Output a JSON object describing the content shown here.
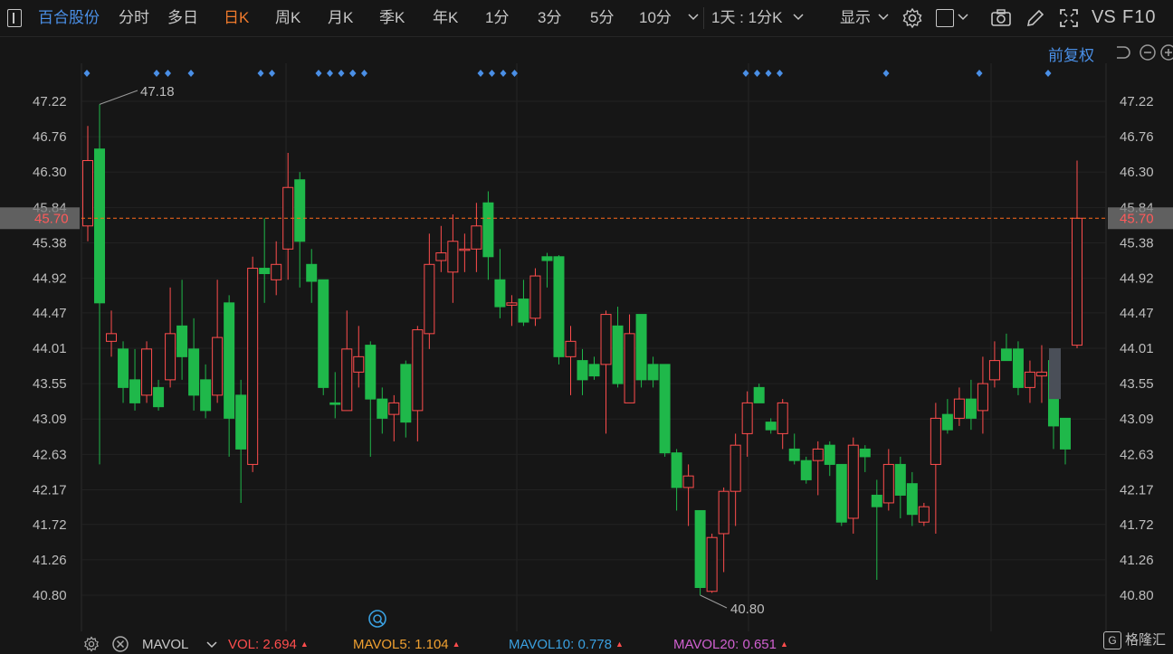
{
  "toolbar": {
    "stock_name": "百合股份",
    "periods": [
      "分时",
      "多日",
      "日K",
      "周K",
      "月K",
      "季K",
      "年K",
      "1分",
      "3分",
      "5分",
      "10分"
    ],
    "active_period": "日K",
    "interval_selector": "1天 : 1分K",
    "display_label": "显示",
    "vs_label": "VS",
    "f10_label": "F10"
  },
  "adjust_label": "前复权",
  "price_axis": {
    "ticks": [
      "47.22",
      "46.76",
      "46.30",
      "45.84",
      "45.38",
      "44.92",
      "44.47",
      "44.01",
      "43.55",
      "43.09",
      "42.63",
      "42.17",
      "41.72",
      "41.26",
      "40.80"
    ],
    "current_price": "45.70",
    "max_marker": "47.18",
    "min_marker": "40.80"
  },
  "colors": {
    "up": "#ff4d4d",
    "down": "#1fb84a",
    "marker": "#4a8fe6",
    "dashed": "#ff6a1a",
    "current_bg": "#7a7a7a"
  },
  "chart_data": {
    "type": "candlestick",
    "ylim": [
      40.8,
      47.22
    ],
    "candles": [
      {
        "o": 45.6,
        "c": 46.45,
        "h": 46.9,
        "l": 45.4
      },
      {
        "o": 46.6,
        "c": 44.6,
        "h": 47.18,
        "l": 42.5
      },
      {
        "o": 44.1,
        "c": 44.2,
        "h": 44.5,
        "l": 43.9
      },
      {
        "o": 44.0,
        "c": 43.5,
        "h": 44.1,
        "l": 43.3
      },
      {
        "o": 43.6,
        "c": 43.3,
        "h": 44.0,
        "l": 43.2
      },
      {
        "o": 43.4,
        "c": 44.0,
        "h": 44.1,
        "l": 43.3
      },
      {
        "o": 43.5,
        "c": 43.25,
        "h": 43.6,
        "l": 43.2
      },
      {
        "o": 43.6,
        "c": 44.2,
        "h": 44.8,
        "l": 43.5
      },
      {
        "o": 44.3,
        "c": 43.9,
        "h": 44.9,
        "l": 43.6
      },
      {
        "o": 44.0,
        "c": 43.4,
        "h": 44.4,
        "l": 43.2
      },
      {
        "o": 43.6,
        "c": 43.2,
        "h": 43.8,
        "l": 43.1
      },
      {
        "o": 43.4,
        "c": 44.15,
        "h": 44.9,
        "l": 43.3
      },
      {
        "o": 44.6,
        "c": 43.1,
        "h": 44.7,
        "l": 42.6
      },
      {
        "o": 43.4,
        "c": 42.7,
        "h": 43.6,
        "l": 42.0
      },
      {
        "o": 42.5,
        "c": 45.05,
        "h": 45.2,
        "l": 42.4
      },
      {
        "o": 45.05,
        "c": 44.98,
        "h": 45.7,
        "l": 44.6
      },
      {
        "o": 44.9,
        "c": 45.1,
        "h": 45.4,
        "l": 44.7
      },
      {
        "o": 45.3,
        "c": 46.1,
        "h": 46.55,
        "l": 44.9
      },
      {
        "o": 46.2,
        "c": 45.4,
        "h": 46.3,
        "l": 44.8
      },
      {
        "o": 45.1,
        "c": 44.88,
        "h": 45.3,
        "l": 44.6
      },
      {
        "o": 44.9,
        "c": 43.5,
        "h": 44.9,
        "l": 43.4
      },
      {
        "o": 43.3,
        "c": 43.28,
        "h": 43.7,
        "l": 43.1
      },
      {
        "o": 43.2,
        "c": 44.0,
        "h": 44.5,
        "l": 43.2
      },
      {
        "o": 43.7,
        "c": 43.9,
        "h": 44.3,
        "l": 43.5
      },
      {
        "o": 44.05,
        "c": 43.35,
        "h": 44.1,
        "l": 42.6
      },
      {
        "o": 43.35,
        "c": 43.1,
        "h": 43.5,
        "l": 42.9
      },
      {
        "o": 43.15,
        "c": 43.3,
        "h": 43.4,
        "l": 42.8
      },
      {
        "o": 43.8,
        "c": 43.05,
        "h": 43.85,
        "l": 42.85
      },
      {
        "o": 43.2,
        "c": 44.25,
        "h": 44.3,
        "l": 42.8
      },
      {
        "o": 44.2,
        "c": 45.1,
        "h": 45.5,
        "l": 44.0
      },
      {
        "o": 45.15,
        "c": 45.25,
        "h": 45.6,
        "l": 45.0
      },
      {
        "o": 45.0,
        "c": 45.4,
        "h": 45.75,
        "l": 44.6
      },
      {
        "o": 45.3,
        "c": 45.3,
        "h": 45.5,
        "l": 45.0
      },
      {
        "o": 45.3,
        "c": 45.6,
        "h": 45.9,
        "l": 45.0
      },
      {
        "o": 45.9,
        "c": 45.2,
        "h": 46.05,
        "l": 44.9
      },
      {
        "o": 44.9,
        "c": 44.55,
        "h": 45.3,
        "l": 44.4
      },
      {
        "o": 44.57,
        "c": 44.6,
        "h": 44.7,
        "l": 44.3
      },
      {
        "o": 44.65,
        "c": 44.35,
        "h": 44.9,
        "l": 44.3
      },
      {
        "o": 44.4,
        "c": 44.95,
        "h": 45.05,
        "l": 44.3
      },
      {
        "o": 45.2,
        "c": 45.15,
        "h": 45.25,
        "l": 44.8
      },
      {
        "o": 45.2,
        "c": 43.9,
        "h": 45.22,
        "l": 43.8
      },
      {
        "o": 43.9,
        "c": 44.1,
        "h": 44.3,
        "l": 43.4
      },
      {
        "o": 43.85,
        "c": 43.6,
        "h": 44.0,
        "l": 43.4
      },
      {
        "o": 43.8,
        "c": 43.65,
        "h": 43.9,
        "l": 43.6
      },
      {
        "o": 43.8,
        "c": 44.45,
        "h": 44.5,
        "l": 42.9
      },
      {
        "o": 44.3,
        "c": 43.55,
        "h": 44.55,
        "l": 43.5
      },
      {
        "o": 43.3,
        "c": 44.2,
        "h": 44.45,
        "l": 43.3
      },
      {
        "o": 44.45,
        "c": 43.6,
        "h": 44.45,
        "l": 43.5
      },
      {
        "o": 43.8,
        "c": 43.6,
        "h": 43.9,
        "l": 43.5
      },
      {
        "o": 43.8,
        "c": 42.65,
        "h": 43.8,
        "l": 42.6
      },
      {
        "o": 42.65,
        "c": 42.2,
        "h": 42.7,
        "l": 41.9
      },
      {
        "o": 42.2,
        "c": 42.35,
        "h": 42.5,
        "l": 41.7
      },
      {
        "o": 41.9,
        "c": 40.9,
        "h": 41.9,
        "l": 40.8
      },
      {
        "o": 40.85,
        "c": 41.55,
        "h": 41.6,
        "l": 40.83
      },
      {
        "o": 41.6,
        "c": 42.15,
        "h": 42.2,
        "l": 41.1
      },
      {
        "o": 42.15,
        "c": 42.75,
        "h": 42.9,
        "l": 41.7
      },
      {
        "o": 42.9,
        "c": 43.3,
        "h": 43.45,
        "l": 42.6
      },
      {
        "o": 43.5,
        "c": 43.3,
        "h": 43.55,
        "l": 43.3
      },
      {
        "o": 43.05,
        "c": 42.95,
        "h": 43.1,
        "l": 42.9
      },
      {
        "o": 42.9,
        "c": 43.3,
        "h": 43.35,
        "l": 42.7
      },
      {
        "o": 42.7,
        "c": 42.55,
        "h": 42.9,
        "l": 42.5
      },
      {
        "o": 42.55,
        "c": 42.3,
        "h": 42.6,
        "l": 42.25
      },
      {
        "o": 42.55,
        "c": 42.7,
        "h": 42.8,
        "l": 42.1
      },
      {
        "o": 42.75,
        "c": 42.5,
        "h": 42.8,
        "l": 42.35
      },
      {
        "o": 42.5,
        "c": 41.75,
        "h": 42.5,
        "l": 41.7
      },
      {
        "o": 41.8,
        "c": 42.75,
        "h": 42.85,
        "l": 41.6
      },
      {
        "o": 42.7,
        "c": 42.6,
        "h": 42.75,
        "l": 42.4
      },
      {
        "o": 42.1,
        "c": 41.95,
        "h": 42.3,
        "l": 41.0
      },
      {
        "o": 42.0,
        "c": 42.5,
        "h": 42.7,
        "l": 41.9
      },
      {
        "o": 42.5,
        "c": 42.1,
        "h": 42.6,
        "l": 41.8
      },
      {
        "o": 42.25,
        "c": 41.85,
        "h": 42.4,
        "l": 41.7
      },
      {
        "o": 41.75,
        "c": 41.95,
        "h": 42.0,
        "l": 41.7
      },
      {
        "o": 42.5,
        "c": 43.1,
        "h": 43.3,
        "l": 41.6
      },
      {
        "o": 43.15,
        "c": 42.95,
        "h": 43.35,
        "l": 42.9
      },
      {
        "o": 43.1,
        "c": 43.35,
        "h": 43.5,
        "l": 43.0
      },
      {
        "o": 43.35,
        "c": 43.1,
        "h": 43.6,
        "l": 42.95
      },
      {
        "o": 43.2,
        "c": 43.55,
        "h": 43.9,
        "l": 42.9
      },
      {
        "o": 43.6,
        "c": 43.85,
        "h": 44.1,
        "l": 43.5
      },
      {
        "o": 44.0,
        "c": 43.85,
        "h": 44.2,
        "l": 43.85
      },
      {
        "o": 44.0,
        "c": 43.5,
        "h": 44.1,
        "l": 43.4
      },
      {
        "o": 43.5,
        "c": 43.7,
        "h": 43.85,
        "l": 43.3
      },
      {
        "o": 43.65,
        "c": 43.7,
        "h": 44.05,
        "l": 43.3
      },
      {
        "o": 43.85,
        "c": 43.0,
        "h": 43.9,
        "l": 42.7
      },
      {
        "o": 43.1,
        "c": 42.7,
        "h": 43.1,
        "l": 42.5
      },
      {
        "o": 44.05,
        "c": 45.7,
        "h": 46.45,
        "l": 44.01
      }
    ],
    "signal_groups": [
      1,
      2,
      1,
      2,
      4,
      2,
      4,
      4,
      1,
      1,
      1,
      1
    ],
    "current_price": 45.7
  },
  "bottom_bar": {
    "indicator": "MAVOL",
    "vol_label": "VOL:",
    "vol_value": "2.694",
    "mavol5_label": "MAVOL5:",
    "mavol5_value": "1.104",
    "mavol10_label": "MAVOL10:",
    "mavol10_value": "0.778",
    "mavol20_label": "MAVOL20:",
    "mavol20_value": "0.651",
    "colors": {
      "vol": "#ff4d4d",
      "mavol5": "#f0a030",
      "mavol10": "#3aa0e0",
      "mavol20": "#d060d0"
    }
  },
  "watermark": "格隆汇"
}
